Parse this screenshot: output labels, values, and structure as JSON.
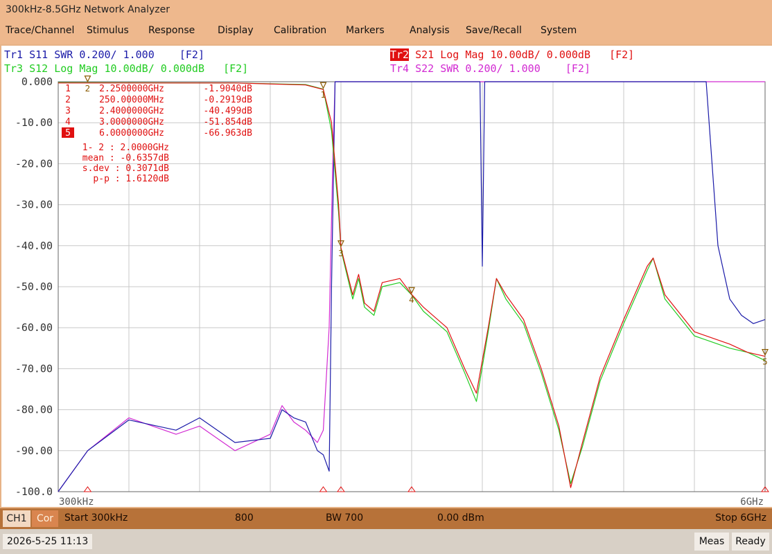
{
  "app": {
    "title": "300kHz-8.5GHz Network Analyzer"
  },
  "menu": [
    "Trace/Channel",
    "Stimulus",
    "Response",
    "Display",
    "Calibration",
    "Markers",
    "Analysis",
    "Save/Recall",
    "System"
  ],
  "traces": [
    {
      "id": "Tr1",
      "rest": " S11 SWR 0.200/ 1.000    [F2]",
      "color": "#1a1aa8"
    },
    {
      "id": "Tr2",
      "rest": " S21 Log Mag 10.00dB/ 0.000dB   [F2]",
      "color": "#e01010"
    },
    {
      "id": "Tr3",
      "rest": " S12 Log Mag 10.00dB/ 0.000dB   [F2]",
      "color": "#22cc22"
    },
    {
      "id": "Tr4",
      "rest": " S22 SWR 0.200/ 1.000    [F2]",
      "color": "#d22ad2"
    }
  ],
  "y_ticks": [
    "0.000",
    "-10.00",
    "-20.00",
    "-30.00",
    "-40.00",
    "-50.00",
    "-60.00",
    "-70.00",
    "-80.00",
    "-90.00",
    "-100.0"
  ],
  "x_start_label": "300kHz",
  "x_stop_label": "6GHz",
  "markers": [
    {
      "num": "1",
      "freq": "2.2500000GHz",
      "value": "-1.9040dB",
      "active": false
    },
    {
      "num": "2",
      "freq": "250.00000MHz",
      "value": "-0.2919dB",
      "active": false
    },
    {
      "num": "3",
      "freq": "2.4000000GHz",
      "value": "-40.499dB",
      "active": false
    },
    {
      "num": "4",
      "freq": "3.0000000GHz",
      "value": "-51.854dB",
      "active": false
    },
    {
      "num": "5",
      "freq": "6.0000000GHz",
      "value": "-66.963dB",
      "active": true
    }
  ],
  "stats": [
    "1- 2 : 2.0000GHz",
    "mean : -0.6357dB",
    "s.dev : 0.3071dB",
    "p-p : 1.6120dB"
  ],
  "status": {
    "channel": "CH1",
    "cor": "Cor",
    "start": "Start 300kHz",
    "points": "800",
    "bw": "BW 700",
    "power": "0.00 dBm",
    "stop": "Stop 6GHz"
  },
  "bottom": {
    "datetime": "2026-5-25 11:13",
    "meas": "Meas",
    "ready": "Ready"
  },
  "colors": {
    "grid": "#c8c8c8",
    "tr1": "#1a1aa8",
    "tr2": "#e01010",
    "tr3": "#22cc22",
    "tr4": "#d22ad2",
    "marker": "#8a5a00"
  },
  "chart_data": {
    "type": "line",
    "x_unit": "GHz",
    "xlim": [
      0.0003,
      6
    ],
    "ylim": [
      -100,
      0
    ],
    "y_unit": "dB",
    "series": [
      {
        "name": "S21",
        "trace": "Tr2",
        "points": [
          [
            0,
            -0.3
          ],
          [
            1.5,
            -0.3
          ],
          [
            2.1,
            -0.8
          ],
          [
            2.25,
            -1.9
          ],
          [
            2.32,
            -10
          ],
          [
            2.38,
            -30
          ],
          [
            2.4,
            -40.5
          ],
          [
            2.5,
            -52
          ],
          [
            2.55,
            -47
          ],
          [
            2.6,
            -54
          ],
          [
            2.68,
            -56
          ],
          [
            2.75,
            -49
          ],
          [
            2.9,
            -48
          ],
          [
            3.0,
            -51.9
          ],
          [
            3.1,
            -55
          ],
          [
            3.3,
            -60
          ],
          [
            3.45,
            -70
          ],
          [
            3.55,
            -76
          ],
          [
            3.65,
            -60
          ],
          [
            3.72,
            -48
          ],
          [
            3.8,
            -52
          ],
          [
            3.95,
            -58
          ],
          [
            4.1,
            -70
          ],
          [
            4.25,
            -84
          ],
          [
            4.35,
            -99
          ],
          [
            4.45,
            -88
          ],
          [
            4.6,
            -72
          ],
          [
            4.8,
            -58
          ],
          [
            5.0,
            -45
          ],
          [
            5.05,
            -43
          ],
          [
            5.15,
            -52
          ],
          [
            5.4,
            -61
          ],
          [
            5.7,
            -64
          ],
          [
            5.85,
            -66
          ],
          [
            6.0,
            -67
          ]
        ]
      },
      {
        "name": "S12",
        "trace": "Tr3",
        "points": [
          [
            0,
            -0.2
          ],
          [
            1.5,
            -0.3
          ],
          [
            2.1,
            -0.7
          ],
          [
            2.25,
            -1.8
          ],
          [
            2.32,
            -12
          ],
          [
            2.38,
            -32
          ],
          [
            2.4,
            -41
          ],
          [
            2.5,
            -53
          ],
          [
            2.55,
            -48
          ],
          [
            2.6,
            -55
          ],
          [
            2.68,
            -57
          ],
          [
            2.75,
            -50
          ],
          [
            2.9,
            -49
          ],
          [
            3.0,
            -52
          ],
          [
            3.1,
            -56
          ],
          [
            3.3,
            -61
          ],
          [
            3.45,
            -71
          ],
          [
            3.55,
            -78
          ],
          [
            3.65,
            -61
          ],
          [
            3.72,
            -48
          ],
          [
            3.8,
            -53
          ],
          [
            3.95,
            -59
          ],
          [
            4.1,
            -71
          ],
          [
            4.25,
            -85
          ],
          [
            4.35,
            -98
          ],
          [
            4.45,
            -89
          ],
          [
            4.6,
            -73
          ],
          [
            4.8,
            -59
          ],
          [
            5.0,
            -46
          ],
          [
            5.05,
            -43
          ],
          [
            5.15,
            -53
          ],
          [
            5.4,
            -62
          ],
          [
            5.7,
            -65
          ],
          [
            5.85,
            -66
          ],
          [
            6.0,
            -68
          ]
        ]
      },
      {
        "name": "S11",
        "trace": "Tr1",
        "points": [
          [
            0,
            -100
          ],
          [
            0.25,
            -90
          ],
          [
            0.6,
            -82.5
          ],
          [
            1.0,
            -85
          ],
          [
            1.2,
            -82
          ],
          [
            1.5,
            -88
          ],
          [
            1.8,
            -87
          ],
          [
            1.9,
            -80
          ],
          [
            2.0,
            -82
          ],
          [
            2.1,
            -83
          ],
          [
            2.2,
            -90
          ],
          [
            2.25,
            -91
          ],
          [
            2.3,
            -95
          ],
          [
            2.32,
            -50
          ],
          [
            2.35,
            0
          ],
          [
            2.4,
            0
          ],
          [
            3.58,
            0
          ],
          [
            3.6,
            -45
          ],
          [
            3.62,
            0
          ],
          [
            5.5,
            0
          ],
          [
            5.55,
            -20
          ],
          [
            5.6,
            -40
          ],
          [
            5.7,
            -53
          ],
          [
            5.8,
            -57
          ],
          [
            5.9,
            -59
          ],
          [
            6.0,
            -58
          ]
        ]
      },
      {
        "name": "S22",
        "trace": "Tr4",
        "points": [
          [
            0,
            -100
          ],
          [
            0.25,
            -90
          ],
          [
            0.6,
            -82
          ],
          [
            1.0,
            -86
          ],
          [
            1.2,
            -84
          ],
          [
            1.5,
            -90
          ],
          [
            1.8,
            -86
          ],
          [
            1.9,
            -79
          ],
          [
            2.0,
            -83
          ],
          [
            2.1,
            -85
          ],
          [
            2.2,
            -88
          ],
          [
            2.25,
            -85
          ],
          [
            2.3,
            -60
          ],
          [
            2.33,
            -20
          ],
          [
            2.35,
            0
          ],
          [
            6.0,
            0
          ]
        ]
      }
    ],
    "marker_positions": [
      {
        "num": "1",
        "x": 2.25,
        "y": -1.9
      },
      {
        "num": "2",
        "x": 0.25,
        "y": -0.3
      },
      {
        "num": "3",
        "x": 2.4,
        "y": -40.5
      },
      {
        "num": "4",
        "x": 3.0,
        "y": -51.9
      },
      {
        "num": "5",
        "x": 6.0,
        "y": -67
      }
    ]
  }
}
